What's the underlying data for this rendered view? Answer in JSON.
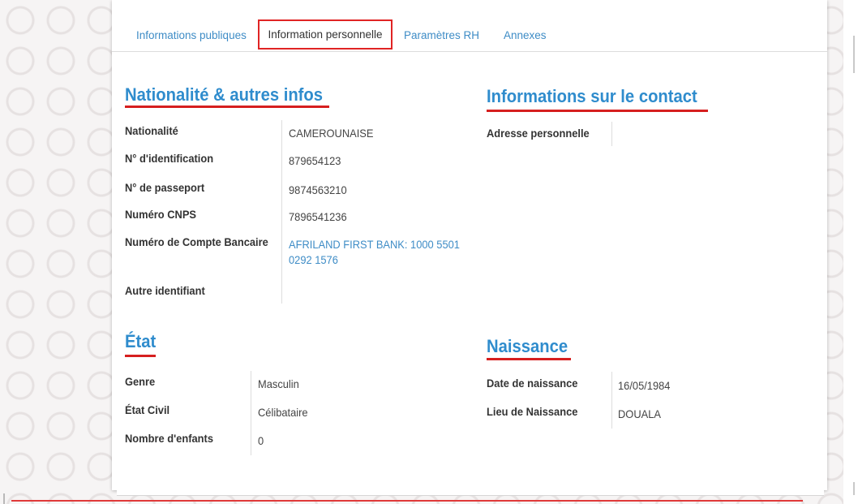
{
  "tabs": [
    {
      "label": "Informations publiques",
      "active": false
    },
    {
      "label": "Information personnelle",
      "active": true
    },
    {
      "label": "Paramètres RH",
      "active": false
    },
    {
      "label": "Annexes",
      "active": false
    }
  ],
  "nationality": {
    "title": "Nationalité & autres infos",
    "rows": [
      {
        "label": "Nationalité",
        "value": "CAMEROUNAISE"
      },
      {
        "label": "N° d'identification",
        "value": "879654123"
      },
      {
        "label": "N° de passeport",
        "value": "9874563210"
      },
      {
        "label": "Numéro CNPS",
        "value": "7896541236"
      },
      {
        "label": "Numéro de Compte Bancaire",
        "value": "AFRILAND FIRST BANK: 1000 5501 0292 1576"
      },
      {
        "label": "Autre identifiant",
        "value": ""
      }
    ]
  },
  "contact": {
    "title": "Informations sur le contact",
    "rows": [
      {
        "label": "Adresse personnelle",
        "value": ""
      }
    ]
  },
  "status": {
    "title": "État",
    "rows": [
      {
        "label": "Genre",
        "value": "Masculin"
      },
      {
        "label": "État Civil",
        "value": "Célibataire"
      },
      {
        "label": "Nombre d'enfants",
        "value": "0"
      }
    ]
  },
  "birth": {
    "title": "Naissance",
    "rows": [
      {
        "label": "Date de naissance",
        "value": "16/05/1984"
      },
      {
        "label": "Lieu de Naissance",
        "value": "DOUALA"
      }
    ]
  },
  "colors": {
    "accent": "#2f8ccd",
    "highlight": "#e02424"
  }
}
